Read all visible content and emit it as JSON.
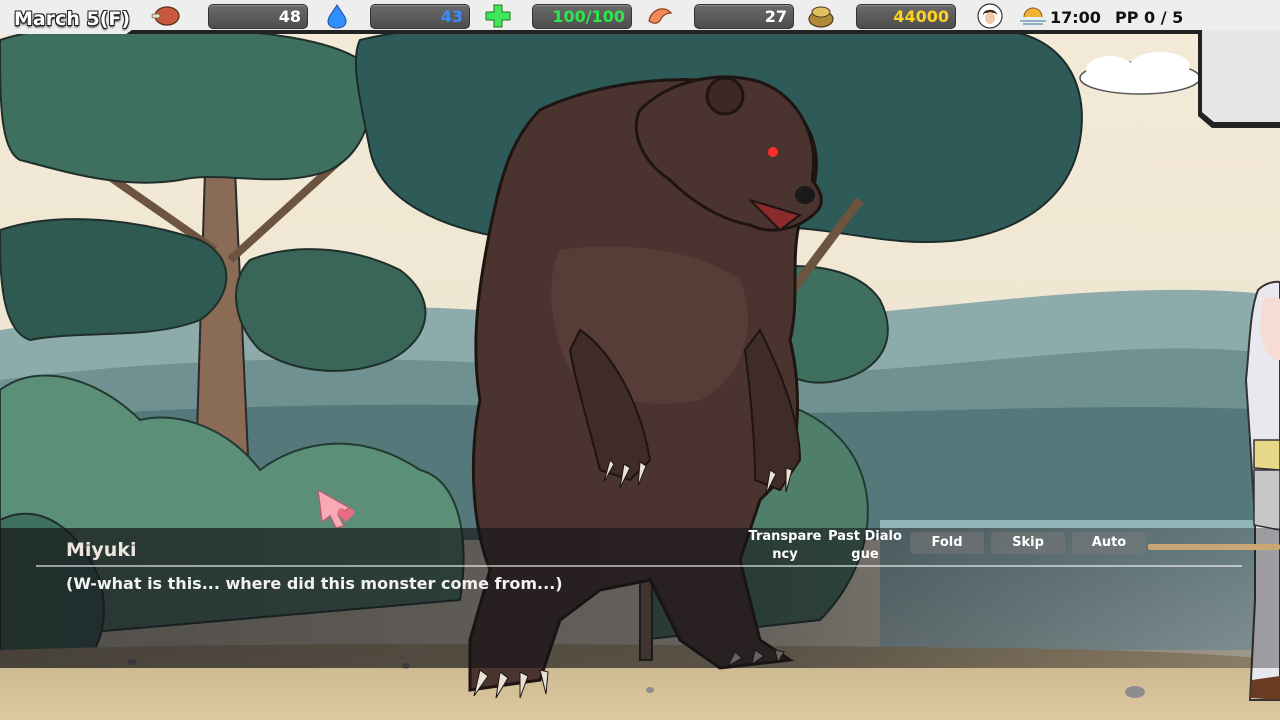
{
  "hud": {
    "date": "March 5(F)",
    "stats": [
      {
        "icon": "meat-icon",
        "value": "48",
        "color": "#ffffff"
      },
      {
        "icon": "water-drop-icon",
        "value": "43",
        "color": "#3a8bff"
      },
      {
        "icon": "health-cross-icon",
        "value": "100/100",
        "color": "#2ee64b"
      },
      {
        "icon": "shrimp-icon",
        "value": "27",
        "color": "#ffffff"
      },
      {
        "icon": "money-pouch-icon",
        "value": "44000",
        "color": "#ffd21e"
      }
    ],
    "time": "17:00",
    "pp": "PP 0 / 5"
  },
  "dialogue": {
    "speaker": "Miyuki",
    "text": "(W-what is this... where did this monster come from...)",
    "controls": {
      "transparency": "Transpare\nncy",
      "past_dialogue": "Past Dialo\ngue",
      "fold": "Fold",
      "skip": "Skip",
      "auto": "Auto"
    }
  }
}
